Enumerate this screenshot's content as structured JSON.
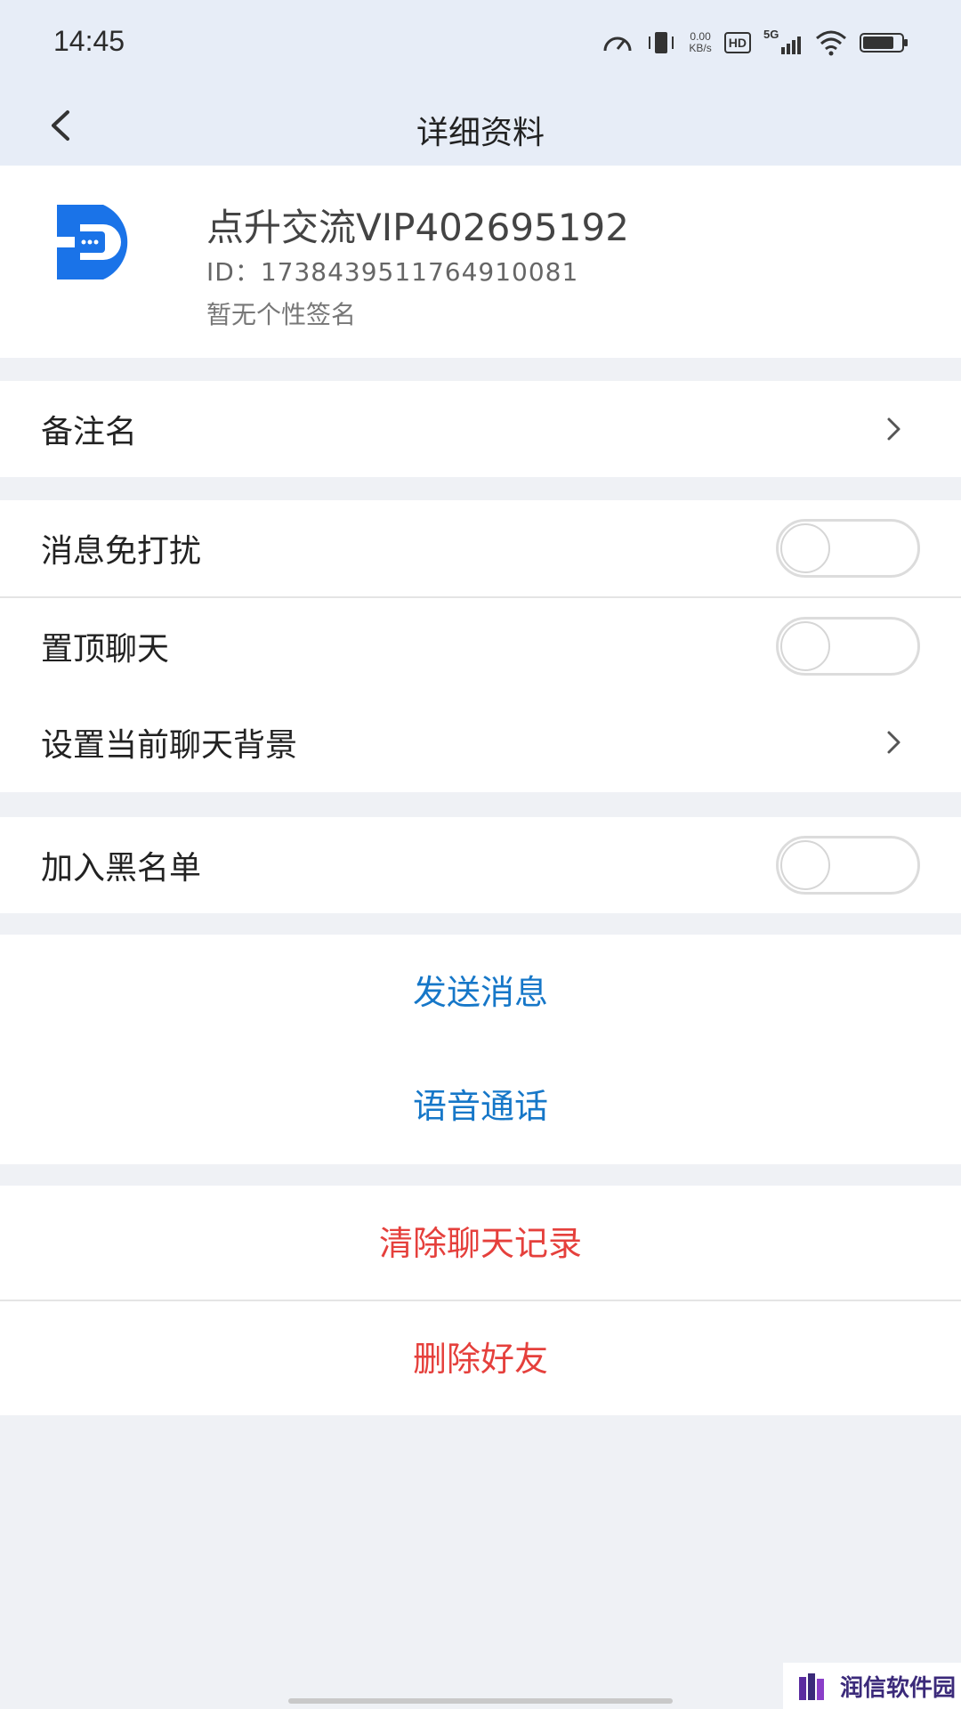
{
  "status_bar": {
    "time": "14:45",
    "net_speed_value": "0.00",
    "net_speed_unit": "KB/s",
    "hd": "HD",
    "signal": "5G",
    "icons": [
      "speedometer-icon",
      "vibrate-icon",
      "signal-icon",
      "wifi-icon",
      "battery-icon"
    ]
  },
  "nav": {
    "title": "详细资料",
    "back_icon": "chevron-left-icon"
  },
  "profile": {
    "name": "点升交流VIP402695192",
    "id": "ID：1738439511764910081",
    "signature": "暂无个性签名",
    "avatar_letter": "D",
    "avatar_color": "#1a73e8"
  },
  "rows": {
    "remark": "备注名",
    "do_not_disturb": "消息免打扰",
    "pin_chat": "置顶聊天",
    "chat_background": "设置当前聊天背景",
    "blacklist": "加入黑名单"
  },
  "toggles": {
    "do_not_disturb": false,
    "pin_chat": false,
    "blacklist": false
  },
  "actions": {
    "send_message": "发送消息",
    "voice_call": "语音通话",
    "clear_history": "清除聊天记录",
    "delete_friend": "删除好友"
  },
  "colors": {
    "accent_blue": "#1677c8",
    "danger_red": "#e5403c",
    "background": "#eff1f5",
    "header": "#e7edf7"
  },
  "watermark": {
    "text": "润信软件园"
  }
}
